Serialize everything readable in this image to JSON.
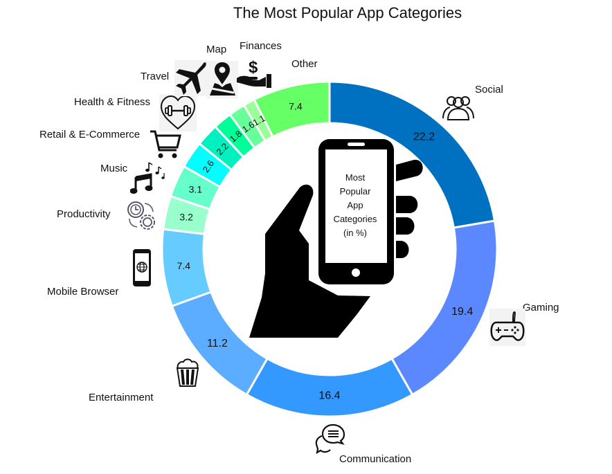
{
  "chart_data": {
    "type": "pie",
    "variant": "donut",
    "title": "The Most Popular App Categories",
    "center_label": [
      "Most",
      "Popular",
      "App",
      "Categories",
      "(in %)"
    ],
    "unit": "%",
    "direction": "clockwise-from-top",
    "categories": [
      "Social",
      "Gaming",
      "Communication",
      "Entertainment",
      "Mobile Browser",
      "Productivity",
      "Music",
      "Retail & E-Commerce",
      "Health & Fitness",
      "Travel",
      "Map",
      "Finances",
      "Other"
    ],
    "values": [
      22.2,
      19.4,
      16.4,
      11.2,
      7.4,
      3.2,
      3.1,
      2.6,
      2.2,
      1.8,
      1.6,
      1.1,
      7.4
    ],
    "value_labels": [
      "22.2",
      "19.4",
      "16.4",
      "11.2",
      "7.4",
      "3.2",
      "3.1",
      "2.6",
      "2.2",
      "1.8",
      "1.6",
      "1.1",
      "7.4"
    ],
    "colors": [
      "#0070C0",
      "#5B87FF",
      "#3399FF",
      "#5CADFF",
      "#66CCFF",
      "#99FFCC",
      "#66FFCC",
      "#00FFFF",
      "#00F0C0",
      "#00FF99",
      "#66FF99",
      "#99FF99",
      "#66FF66"
    ],
    "icons": [
      "people-icon",
      "gamepad-icon",
      "chat-bubbles-icon",
      "popcorn-icon",
      "smartphone-globe-icon",
      "clock-gear-icon",
      "music-notes-icon",
      "shopping-cart-icon",
      "heart-dumbbell-icon",
      "airplane-icon",
      "map-pin-icon",
      "money-hand-icon",
      null
    ]
  }
}
